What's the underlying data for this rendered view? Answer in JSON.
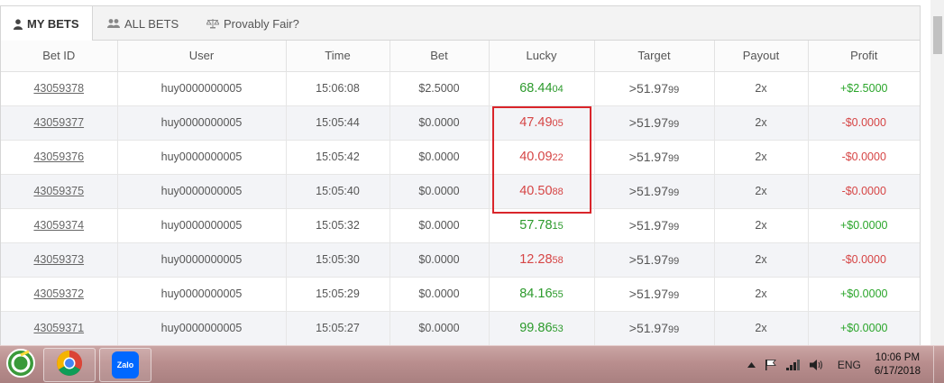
{
  "tabs": [
    {
      "label": "MY BETS",
      "icon": "user-icon",
      "active": true
    },
    {
      "label": "ALL BETS",
      "icon": "users-icon",
      "active": false
    },
    {
      "label": "Provably Fair?",
      "icon": "scale-icon",
      "active": false
    }
  ],
  "columns": [
    "Bet ID",
    "User",
    "Time",
    "Bet",
    "Lucky",
    "Target",
    "Payout",
    "Profit"
  ],
  "rows": [
    {
      "bet_id": "43059378",
      "user": "huy0000000005",
      "time": "15:06:08",
      "bet": "$2.5000",
      "lucky_main": "68.44",
      "lucky_small": "04",
      "lucky_color": "green",
      "target_main": ">51.97",
      "target_small": "99",
      "payout": "2x",
      "profit": "+$2.5000",
      "profit_sign": "pos"
    },
    {
      "bet_id": "43059377",
      "user": "huy0000000005",
      "time": "15:05:44",
      "bet": "$0.0000",
      "lucky_main": "47.49",
      "lucky_small": "05",
      "lucky_color": "red",
      "target_main": ">51.97",
      "target_small": "99",
      "payout": "2x",
      "profit": "-$0.0000",
      "profit_sign": "neg"
    },
    {
      "bet_id": "43059376",
      "user": "huy0000000005",
      "time": "15:05:42",
      "bet": "$0.0000",
      "lucky_main": "40.09",
      "lucky_small": "22",
      "lucky_color": "red",
      "target_main": ">51.97",
      "target_small": "99",
      "payout": "2x",
      "profit": "-$0.0000",
      "profit_sign": "neg"
    },
    {
      "bet_id": "43059375",
      "user": "huy0000000005",
      "time": "15:05:40",
      "bet": "$0.0000",
      "lucky_main": "40.50",
      "lucky_small": "88",
      "lucky_color": "red",
      "target_main": ">51.97",
      "target_small": "99",
      "payout": "2x",
      "profit": "-$0.0000",
      "profit_sign": "neg"
    },
    {
      "bet_id": "43059374",
      "user": "huy0000000005",
      "time": "15:05:32",
      "bet": "$0.0000",
      "lucky_main": "57.78",
      "lucky_small": "15",
      "lucky_color": "green",
      "target_main": ">51.97",
      "target_small": "99",
      "payout": "2x",
      "profit": "+$0.0000",
      "profit_sign": "pos"
    },
    {
      "bet_id": "43059373",
      "user": "huy0000000005",
      "time": "15:05:30",
      "bet": "$0.0000",
      "lucky_main": "12.28",
      "lucky_small": "58",
      "lucky_color": "red",
      "target_main": ">51.97",
      "target_small": "99",
      "payout": "2x",
      "profit": "-$0.0000",
      "profit_sign": "neg"
    },
    {
      "bet_id": "43059372",
      "user": "huy0000000005",
      "time": "15:05:29",
      "bet": "$0.0000",
      "lucky_main": "84.16",
      "lucky_small": "55",
      "lucky_color": "green",
      "target_main": ">51.97",
      "target_small": "99",
      "payout": "2x",
      "profit": "+$0.0000",
      "profit_sign": "pos"
    },
    {
      "bet_id": "43059371",
      "user": "huy0000000005",
      "time": "15:05:27",
      "bet": "$0.0000",
      "lucky_main": "99.86",
      "lucky_small": "53",
      "lucky_color": "green",
      "target_main": ">51.97",
      "target_small": "99",
      "payout": "2x",
      "profit": "+$0.0000",
      "profit_sign": "pos"
    }
  ],
  "taskbar": {
    "apps": [
      {
        "name": "coccoc-browser-icon"
      },
      {
        "name": "chrome-icon"
      },
      {
        "name": "zalo-icon",
        "label": "Zalo"
      }
    ],
    "tray": {
      "language": "ENG",
      "time": "10:06 PM",
      "date": "6/17/2018"
    }
  },
  "colors": {
    "win_green": "#2c9a2c",
    "loss_red": "#d64545",
    "highlight": "#d9252b"
  }
}
